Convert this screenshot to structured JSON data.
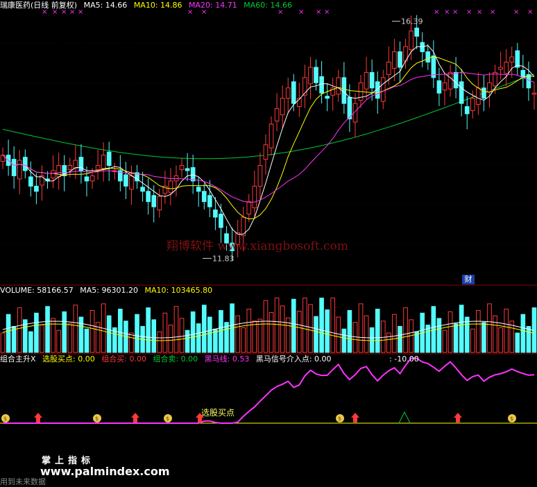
{
  "main_header": {
    "title": "瑞康医药(日线 前复权)",
    "ma5": "MA5: 14.66",
    "ma10": "MA10: 14.86",
    "ma20": "MA20: 14.71",
    "ma60": "MA60: 14.66"
  },
  "volume_header": {
    "volume": "VOLUME: 58166.57",
    "ma5": "MA5: 96301.20",
    "ma10": "MA10: 103465.80"
  },
  "indicator_header": {
    "name": "组合主升X",
    "xuangu": "选股买点: 0.00",
    "zuhe_mai": "组合买: 0.00",
    "zuhe_mai2": "组合卖: 0.00",
    "heima_line": "黑马线: 0.53",
    "heima_signal": "黑马信号介入点: 0.00",
    "other": ": -10.00"
  },
  "labels": {
    "high": "16.39",
    "low": "11.83",
    "signal_text": "选股买点",
    "cai_badge": "财"
  },
  "watermark": "翔博软件 www.xiangbosoft.com",
  "footer": {
    "line1": "掌上指标",
    "line2": "www.palmindex.com",
    "line3": "用到未来数据"
  },
  "colors": {
    "up": "#ff3a3a",
    "down": "#54fcfc",
    "ma5": "#ffffff",
    "ma10": "#ffff00",
    "ma20": "#ff33ff",
    "ma60": "#00cc33",
    "heima": "#ff33ff",
    "baseline": "#ffff00",
    "background": "#000000"
  },
  "chart_data": {
    "type": "candlestick",
    "price_range": [
      11.5,
      16.6
    ],
    "marked_high": 16.39,
    "marked_low": 11.83,
    "indicator_range": [
      -10,
      10
    ]
  }
}
